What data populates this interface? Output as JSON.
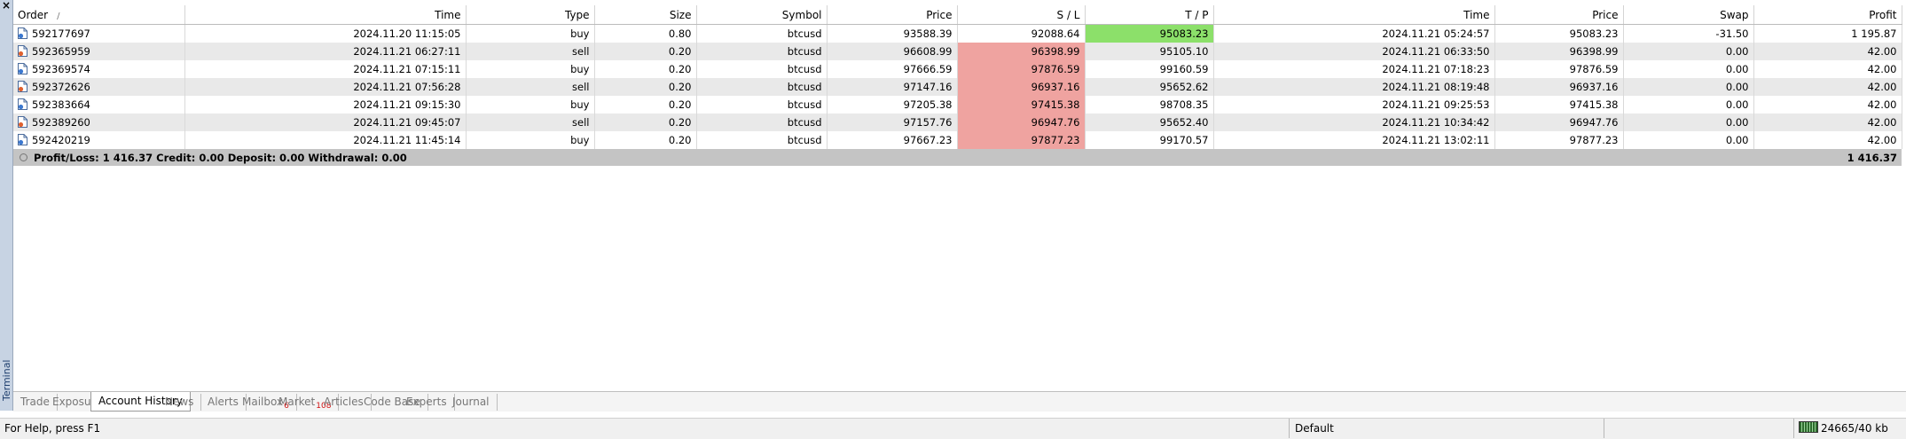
{
  "side_panel": {
    "close_symbol": "×",
    "label": "Terminal"
  },
  "columns": [
    "Order",
    "Time",
    "Type",
    "Size",
    "Symbol",
    "Price",
    "S / L",
    "T / P",
    "Time",
    "Price",
    "Swap",
    "Profit"
  ],
  "sort_indicator": "/",
  "rows": [
    {
      "order": "592177697",
      "open_time": "2024.11.20 11:15:05",
      "type": "buy",
      "size": "0.80",
      "symbol": "btcusd",
      "open_price": "93588.39",
      "sl": "92088.64",
      "tp": "95083.23",
      "close_time": "2024.11.21 05:24:57",
      "close_price": "95083.23",
      "swap": "-31.50",
      "profit": "1 195.87",
      "hit": "tp"
    },
    {
      "order": "592365959",
      "open_time": "2024.11.21 06:27:11",
      "type": "sell",
      "size": "0.20",
      "symbol": "btcusd",
      "open_price": "96608.99",
      "sl": "96398.99",
      "tp": "95105.10",
      "close_time": "2024.11.21 06:33:50",
      "close_price": "96398.99",
      "swap": "0.00",
      "profit": "42.00",
      "hit": "sl"
    },
    {
      "order": "592369574",
      "open_time": "2024.11.21 07:15:11",
      "type": "buy",
      "size": "0.20",
      "symbol": "btcusd",
      "open_price": "97666.59",
      "sl": "97876.59",
      "tp": "99160.59",
      "close_time": "2024.11.21 07:18:23",
      "close_price": "97876.59",
      "swap": "0.00",
      "profit": "42.00",
      "hit": "sl"
    },
    {
      "order": "592372626",
      "open_time": "2024.11.21 07:56:28",
      "type": "sell",
      "size": "0.20",
      "symbol": "btcusd",
      "open_price": "97147.16",
      "sl": "96937.16",
      "tp": "95652.62",
      "close_time": "2024.11.21 08:19:48",
      "close_price": "96937.16",
      "swap": "0.00",
      "profit": "42.00",
      "hit": "sl"
    },
    {
      "order": "592383664",
      "open_time": "2024.11.21 09:15:30",
      "type": "buy",
      "size": "0.20",
      "symbol": "btcusd",
      "open_price": "97205.38",
      "sl": "97415.38",
      "tp": "98708.35",
      "close_time": "2024.11.21 09:25:53",
      "close_price": "97415.38",
      "swap": "0.00",
      "profit": "42.00",
      "hit": "sl"
    },
    {
      "order": "592389260",
      "open_time": "2024.11.21 09:45:07",
      "type": "sell",
      "size": "0.20",
      "symbol": "btcusd",
      "open_price": "97157.76",
      "sl": "96947.76",
      "tp": "95652.40",
      "close_time": "2024.11.21 10:34:42",
      "close_price": "96947.76",
      "swap": "0.00",
      "profit": "42.00",
      "hit": "sl"
    },
    {
      "order": "592420219",
      "open_time": "2024.11.21 11:45:14",
      "type": "buy",
      "size": "0.20",
      "symbol": "btcusd",
      "open_price": "97667.23",
      "sl": "97877.23",
      "tp": "99170.57",
      "close_time": "2024.11.21 13:02:11",
      "close_price": "97877.23",
      "swap": "0.00",
      "profit": "42.00",
      "hit": "sl"
    }
  ],
  "summary": {
    "text": "Profit/Loss: 1 416.37  Credit: 0.00  Deposit: 0.00  Withdrawal: 0.00",
    "total_profit": "1 416.37"
  },
  "tabs": [
    {
      "label": "Trade",
      "badge": ""
    },
    {
      "label": "Exposure",
      "badge": ""
    },
    {
      "label": "Account History",
      "badge": "",
      "active": true
    },
    {
      "label": "News",
      "badge": ""
    },
    {
      "label": "Alerts",
      "badge": ""
    },
    {
      "label": "Mailbox",
      "badge": "6"
    },
    {
      "label": "Market",
      "badge": "108"
    },
    {
      "label": "Articles",
      "badge": ""
    },
    {
      "label": "Code Base",
      "badge": ""
    },
    {
      "label": "Experts",
      "badge": ""
    },
    {
      "label": "Journal",
      "badge": ""
    }
  ],
  "status_bar": {
    "help": "For Help, press F1",
    "profile": "Default",
    "traffic": "24665/40 kb"
  },
  "colors": {
    "sl_hit_bg": "#efa3a0",
    "tp_hit_bg": "#8ce06a",
    "row_alt_bg": "#e9e9e9",
    "total_row_bg": "#c4c4c4",
    "badge_red": "#d01010"
  },
  "icons": {
    "side_close": "close-icon",
    "order_row": "order-document-icon",
    "summary": "summary-bullet-icon",
    "connection": "connection-status-icon"
  }
}
